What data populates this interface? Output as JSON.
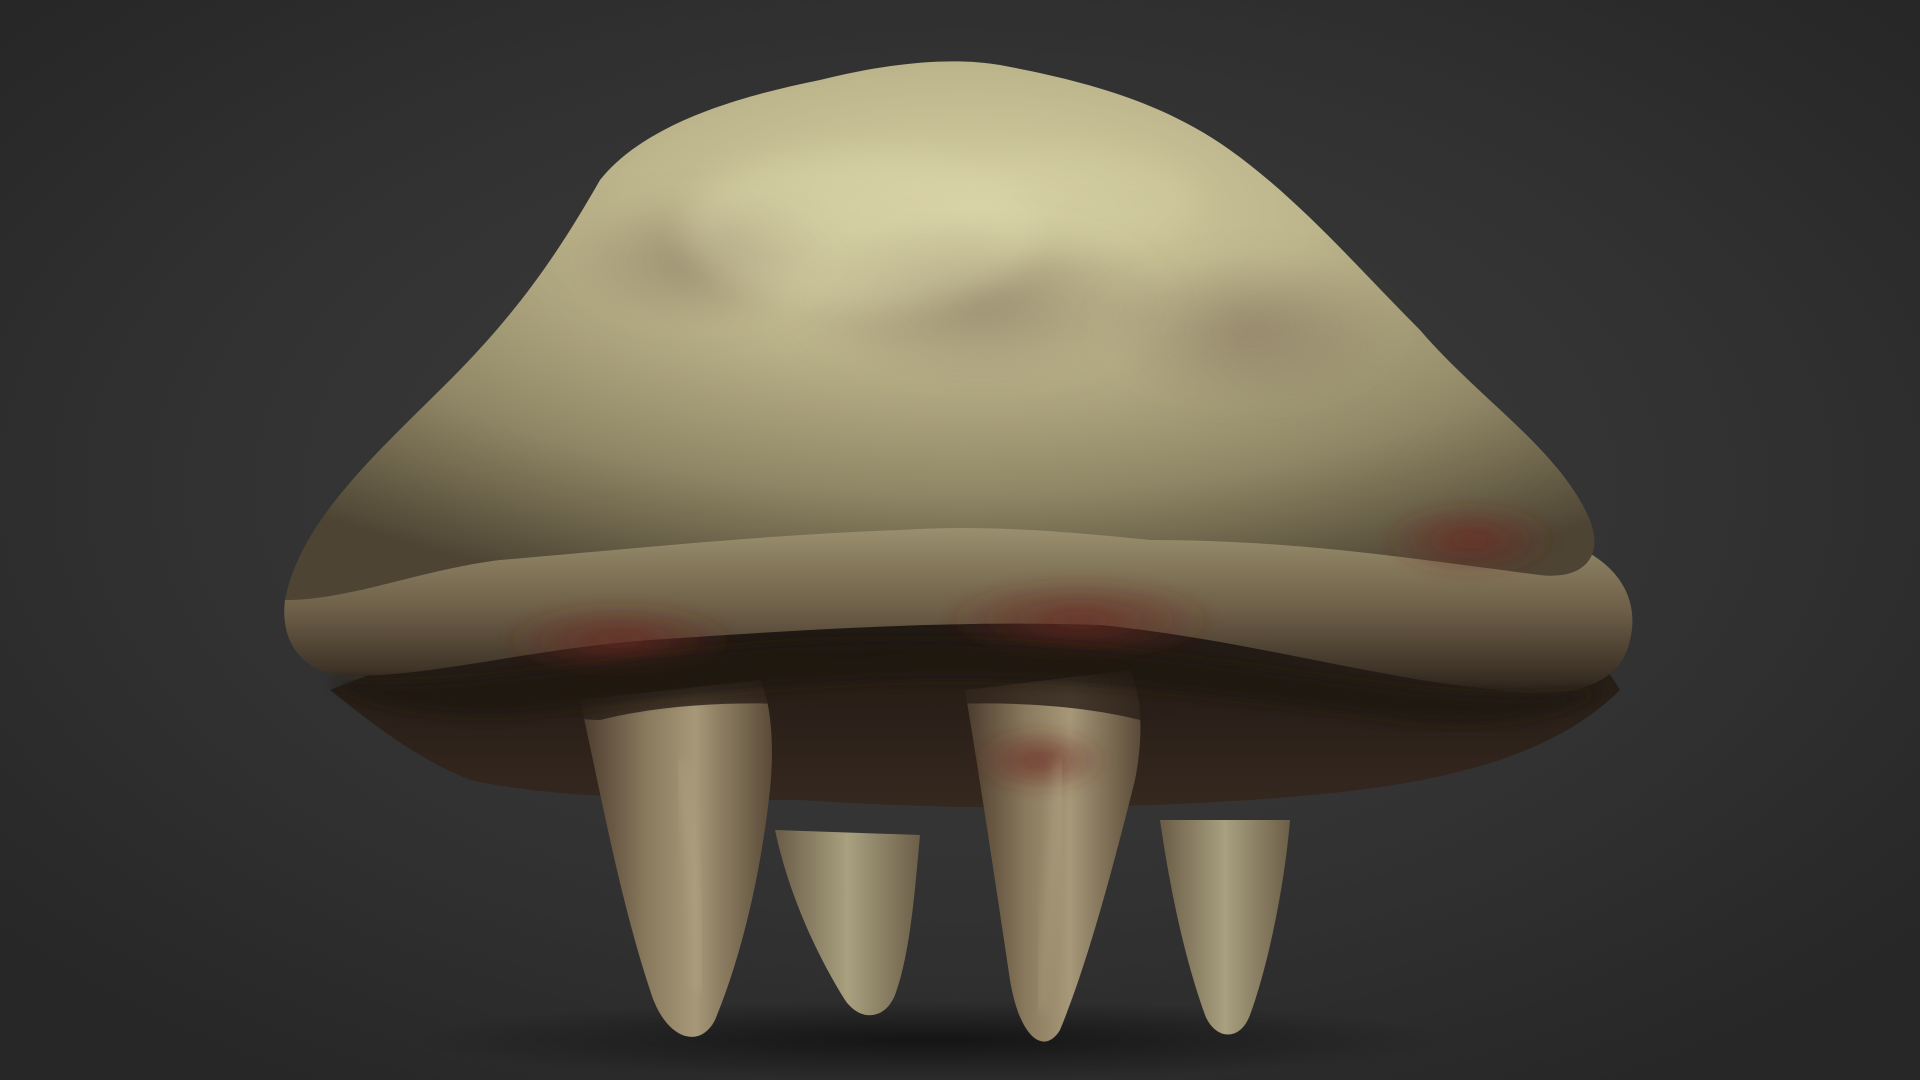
{
  "scene": {
    "subject": "bone-tooth-creature",
    "colors": {
      "background": "#333333",
      "bone_light": "#c9c49a",
      "bone_mid": "#a49d76",
      "bone_shadow": "#5d5340",
      "blood_stain": "#5e2a22",
      "tooth_light": "#a89978",
      "tooth_dark": "#3a2c22"
    }
  }
}
